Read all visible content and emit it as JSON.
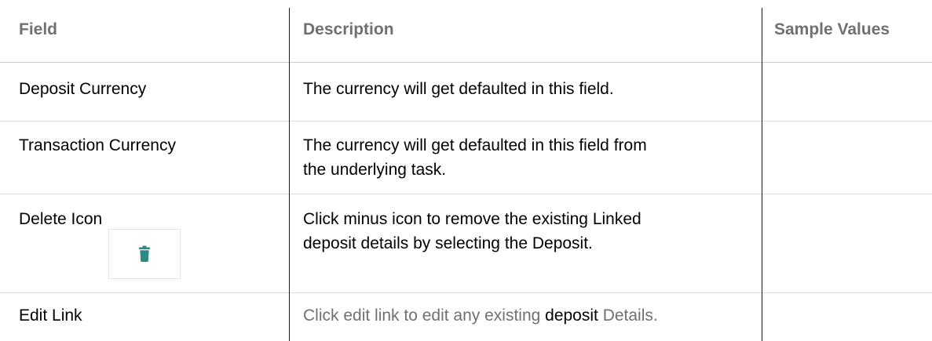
{
  "table": {
    "headers": {
      "field": "Field",
      "description": "Description",
      "sample_values": "Sample Values"
    },
    "rows": [
      {
        "field": "Deposit Currency",
        "description": "The currency will get defaulted in this field.",
        "sample_values": ""
      },
      {
        "field": "Transaction Currency",
        "description_line1": "The currency will get defaulted in this field from",
        "description_line2": "the underlying task.",
        "sample_values": ""
      },
      {
        "field": "Delete Icon",
        "description_line1": "Click minus icon to remove the existing Linked",
        "description_line2": "deposit details by selecting the Deposit.",
        "sample_values": "",
        "icon": "trash-icon",
        "icon_color": "#2e8b84"
      },
      {
        "field": "Edit Link",
        "description_part1": "Click edit link to edit any existing ",
        "description_part2": "deposit",
        "description_part3": " Details.",
        "sample_values": ""
      }
    ]
  },
  "colors": {
    "header_text": "#707070",
    "body_text": "#000000",
    "muted_text": "#707070",
    "grid_line": "#1a1a1a",
    "row_divider": "#dcdcdc"
  }
}
